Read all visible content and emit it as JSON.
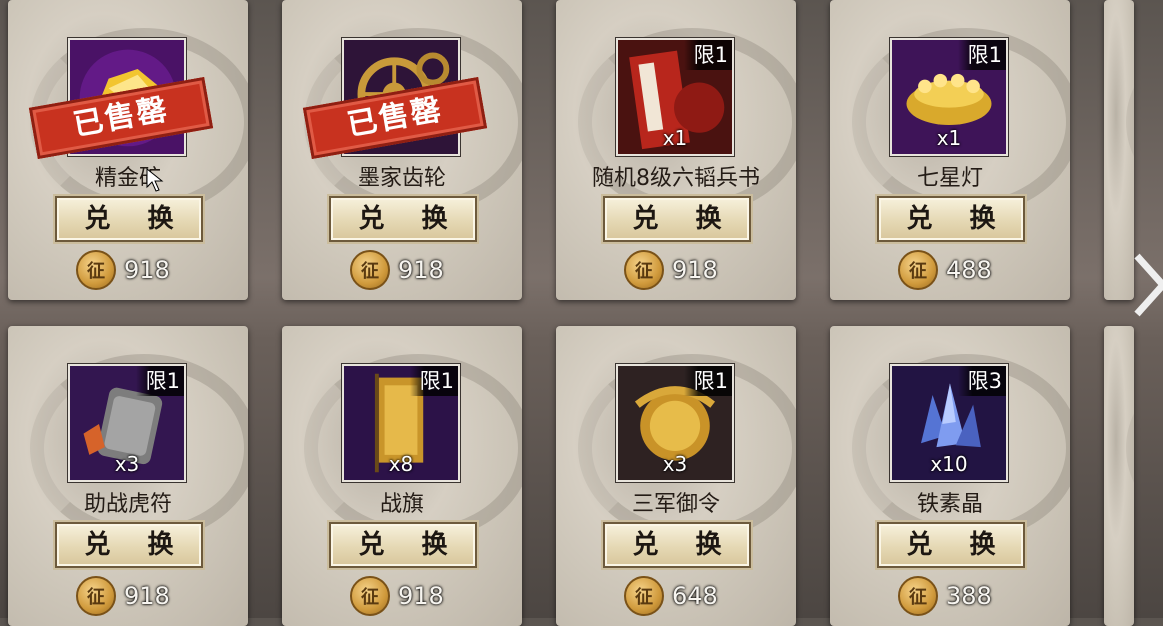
{
  "exchange_label": "兑 换",
  "sold_label": "已售罄",
  "coin_glyph": "征",
  "items": [
    {
      "name": "精金矿",
      "limit": "",
      "qty": "",
      "price": "918",
      "sold": true,
      "icon": "gold-ore-icon",
      "colors": [
        "#5a1a7a",
        "#f2c530"
      ]
    },
    {
      "name": "墨家齿轮",
      "limit": "",
      "qty": "",
      "price": "918",
      "sold": true,
      "icon": "gear-icon",
      "colors": [
        "#3a1c4a",
        "#c99a3a"
      ]
    },
    {
      "name": "随机8级六韬兵书",
      "limit": "限1",
      "qty": "x1",
      "price": "918",
      "sold": false,
      "icon": "war-book-icon",
      "colors": [
        "#5a1412",
        "#c22a20"
      ]
    },
    {
      "name": "七星灯",
      "limit": "限1",
      "qty": "x1",
      "price": "488",
      "sold": false,
      "icon": "seven-star-lamp-icon",
      "colors": [
        "#4a1a6a",
        "#e8c040"
      ]
    },
    {
      "name": "助战虎符",
      "limit": "限1",
      "qty": "x3",
      "price": "918",
      "sold": false,
      "icon": "tiger-tally-icon",
      "colors": [
        "#3a1a5a",
        "#8a8a8a"
      ]
    },
    {
      "name": "战旗",
      "limit": "限1",
      "qty": "x8",
      "price": "918",
      "sold": false,
      "icon": "war-banner-icon",
      "colors": [
        "#3a1a5a",
        "#d0a030"
      ]
    },
    {
      "name": "三军御令",
      "limit": "限1",
      "qty": "x3",
      "price": "648",
      "sold": false,
      "icon": "imperial-order-icon",
      "colors": [
        "#3a2a2a",
        "#e0b040"
      ]
    },
    {
      "name": "铁素晶",
      "limit": "限3",
      "qty": "x10",
      "price": "388",
      "sold": false,
      "icon": "iron-crystal-icon",
      "colors": [
        "#2a1a4a",
        "#6a8ae0"
      ]
    }
  ]
}
